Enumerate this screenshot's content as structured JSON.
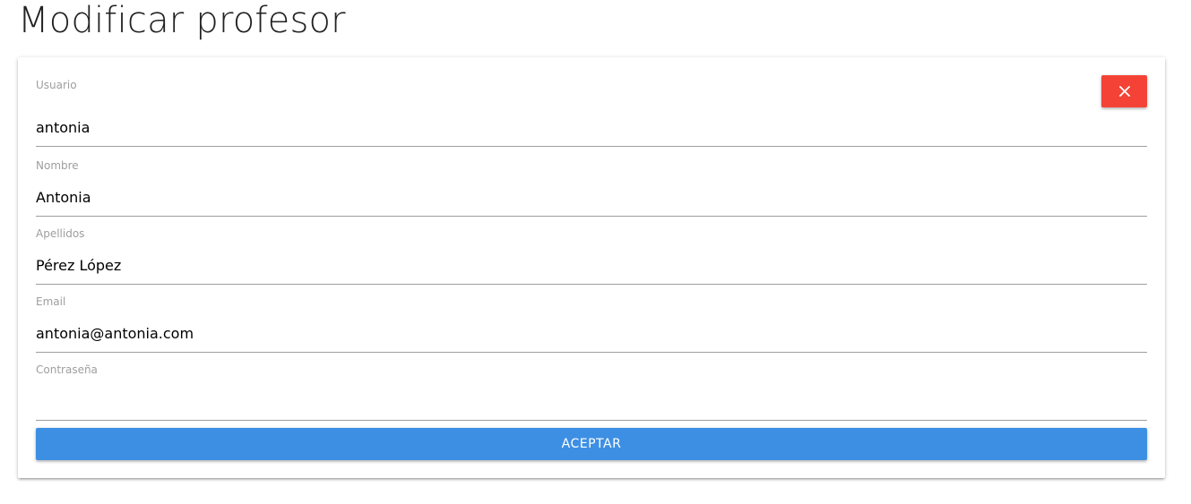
{
  "page": {
    "title": "Modificar profesor"
  },
  "form": {
    "close_icon": "close-icon",
    "fields": {
      "usuario": {
        "label": "Usuario",
        "value": "antonia"
      },
      "nombre": {
        "label": "Nombre",
        "value": "Antonia"
      },
      "apellidos": {
        "label": "Apellidos",
        "value": "Pérez López"
      },
      "email": {
        "label": "Email",
        "value": "antonia@antonia.com"
      },
      "contrasena": {
        "label": "Contraseña",
        "value": ""
      }
    },
    "accept_label": "ACEPTAR"
  },
  "colors": {
    "close_button": "#f44336",
    "accept_button": "#3d8fe4",
    "label": "#9e9e9e",
    "underline": "#9e9e9e"
  }
}
